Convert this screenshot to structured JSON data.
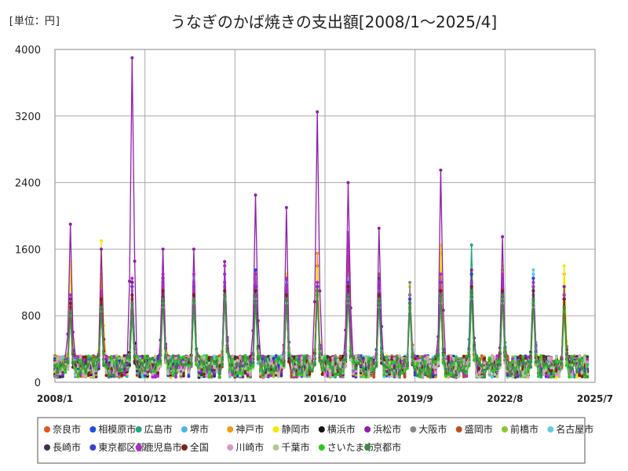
{
  "chart_data": {
    "type": "line",
    "unit_label": "[単位：円]",
    "title": "うなぎのかば焼きの支出額[2008/1～2025/4]",
    "ylim": [
      0,
      4000
    ],
    "yticks": [
      "0",
      "800",
      "1600",
      "2400",
      "3200",
      "4000"
    ],
    "ytick_values": [
      0,
      800,
      1600,
      2400,
      3200,
      4000
    ],
    "xlim": [
      "2008/1",
      "2025/7"
    ],
    "xticks": [
      "2008/1",
      "2010/12",
      "2013/11",
      "2016/10",
      "2019/9",
      "2022/8",
      "2025/7"
    ],
    "grid": true,
    "legend_position": "bottom",
    "x_start": "2008/1",
    "x_end": "2025/4",
    "series": [
      {
        "name": "奈良市",
        "color": "#e8541c",
        "peaks": [
          1000,
          1100,
          900,
          1150,
          950,
          1050,
          1100,
          1000,
          1400,
          1050,
          1300,
          1150,
          1000,
          1200,
          1100,
          1050,
          1000,
          1050
        ]
      },
      {
        "name": "相模原市",
        "color": "#1e50e0",
        "peaks": [
          950,
          1000,
          900,
          1100,
          1000,
          1300,
          1150,
          1100,
          1150,
          1200,
          1250,
          1000,
          1150,
          1250,
          1300,
          1000,
          1150,
          1000
        ]
      },
      {
        "name": "広島市",
        "color": "#20a878",
        "peaks": [
          1000,
          950,
          800,
          1000,
          900,
          1100,
          1200,
          1050,
          1200,
          1350,
          1200,
          1000,
          1250,
          1650,
          1350,
          1100,
          1050,
          950
        ]
      },
      {
        "name": "堺市",
        "color": "#46b8e6",
        "peaks": [
          900,
          950,
          1000,
          1050,
          1100,
          1150,
          1000,
          1100,
          1150,
          1250,
          1100,
          1000,
          1200,
          1200,
          1250,
          1300,
          1000,
          900
        ]
      },
      {
        "name": "神戸市",
        "color": "#f39c12",
        "peaks": [
          1400,
          1300,
          1150,
          1050,
          1100,
          1150,
          1200,
          1300,
          1550,
          1450,
          1000,
          1050,
          1550,
          1300,
          1300,
          1250,
          1300,
          1050
        ]
      },
      {
        "name": "静岡市",
        "color": "#f5e800",
        "peaks": [
          1450,
          1700,
          1200,
          1250,
          1200,
          1100,
          1250,
          1300,
          1350,
          1500,
          1050,
          1150,
          1650,
          1250,
          1400,
          1200,
          1400,
          1000
        ]
      },
      {
        "name": "横浜市",
        "color": "#111111",
        "peaks": [
          1000,
          950,
          1200,
          1250,
          1050,
          1000,
          1100,
          1000,
          1150,
          1200,
          1050,
          950,
          1100,
          1300,
          1100,
          1150,
          1000,
          850
        ]
      },
      {
        "name": "浜松市",
        "color": "#8e1ea8",
        "peaks": [
          1900,
          1600,
          3900,
          1600,
          1600,
          1450,
          2250,
          2100,
          3250,
          2400,
          1850,
          1050,
          2550,
          1350,
          1750,
          1250,
          1150,
          1050
        ]
      },
      {
        "name": "大阪市",
        "color": "#888888",
        "peaks": [
          950,
          1000,
          1150,
          1000,
          1050,
          1000,
          1100,
          1050,
          1100,
          1150,
          1000,
          1200,
          1100,
          1150,
          1100,
          1050,
          900,
          850
        ]
      },
      {
        "name": "盛岡市",
        "color": "#c0501e",
        "peaks": [
          900,
          950,
          1000,
          1050,
          1100,
          1000,
          1050,
          1000,
          1200,
          1550,
          1050,
          950,
          1050,
          1100,
          1050,
          1000,
          1050,
          900
        ]
      },
      {
        "name": "前橋市",
        "color": "#88c832",
        "peaks": [
          850,
          900,
          950,
          1000,
          1000,
          1050,
          1000,
          1050,
          1100,
          1050,
          1000,
          900,
          1050,
          1100,
          1000,
          950,
          850,
          800
        ]
      },
      {
        "name": "名古屋市",
        "color": "#5ccfe0",
        "peaks": [
          950,
          1000,
          1100,
          1050,
          1250,
          1100,
          1200,
          1200,
          1150,
          1250,
          1100,
          1000,
          1200,
          1150,
          1200,
          1350,
          850,
          800
        ]
      },
      {
        "name": "長崎市",
        "color": "#3c3250",
        "peaks": [
          800,
          850,
          900,
          1200,
          950,
          1000,
          1050,
          950,
          1050,
          1100,
          950,
          900,
          1000,
          1050,
          1000,
          950,
          900,
          800
        ]
      },
      {
        "name": "東京都区部",
        "color": "#3c3cd8",
        "peaks": [
          950,
          1000,
          1150,
          1200,
          1150,
          1200,
          1350,
          1250,
          1150,
          1200,
          1250,
          1000,
          1200,
          1300,
          1200,
          1250,
          1000,
          900
        ]
      },
      {
        "name": "鹿児島市",
        "color": "#b428c8",
        "peaks": [
          1050,
          1100,
          1250,
          1300,
          1300,
          1400,
          1300,
          1250,
          1200,
          1800,
          1200,
          950,
          1300,
          1200,
          1300,
          1200,
          1050,
          900
        ]
      },
      {
        "name": "全国",
        "color": "#7a2418",
        "peaks": [
          950,
          1000,
          1050,
          1100,
          1050,
          1100,
          1100,
          1050,
          1100,
          1150,
          1050,
          950,
          1100,
          1150,
          1100,
          1100,
          1000,
          850
        ]
      },
      {
        "name": "川崎市",
        "color": "#dc96c8",
        "peaks": [
          850,
          900,
          950,
          950,
          1000,
          1050,
          1000,
          1000,
          1050,
          1000,
          950,
          900,
          1000,
          1050,
          1000,
          950,
          900,
          800
        ]
      },
      {
        "name": "千葉市",
        "color": "#b4c896",
        "peaks": [
          800,
          850,
          900,
          900,
          950,
          1000,
          950,
          950,
          1000,
          950,
          900,
          850,
          950,
          1000,
          950,
          900,
          850,
          750
        ]
      },
      {
        "name": "さいたま市",
        "color": "#2cc820",
        "peaks": [
          800,
          850,
          900,
          950,
          950,
          1000,
          950,
          1000,
          1050,
          1000,
          950,
          900,
          1000,
          1050,
          1000,
          950,
          850,
          800
        ]
      },
      {
        "name": "京都市",
        "color": "#3c8c46",
        "peaks": [
          850,
          900,
          950,
          1000,
          1000,
          1050,
          1050,
          1000,
          1100,
          1050,
          1000,
          950,
          1050,
          1100,
          1050,
          1000,
          900,
          850
        ]
      }
    ]
  }
}
